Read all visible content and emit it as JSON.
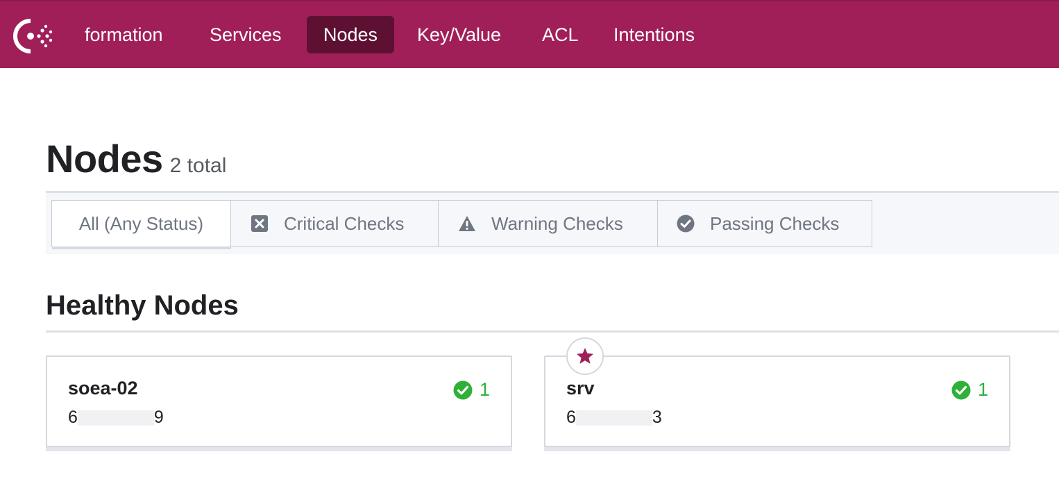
{
  "colors": {
    "brand": "#a01f58",
    "nav_active": "#5e1033",
    "passing": "#2eb039",
    "leader_star": "#a01f58"
  },
  "nav": {
    "logo_icon": "consul-logo-icon",
    "items": [
      {
        "label": "formation",
        "active": false
      },
      {
        "label": "Services",
        "active": false
      },
      {
        "label": "Nodes",
        "active": true
      },
      {
        "label": "Key/Value",
        "active": false
      },
      {
        "label": "ACL",
        "active": false
      },
      {
        "label": "Intentions",
        "active": false
      }
    ]
  },
  "page": {
    "title": "Nodes",
    "count": "2 total"
  },
  "filters": {
    "selected": "All (Any Status)",
    "tabs": [
      {
        "label": "All (Any Status)",
        "icon": null
      },
      {
        "label": "Critical Checks",
        "icon": "critical-x-icon"
      },
      {
        "label": "Warning Checks",
        "icon": "warning-triangle-icon"
      },
      {
        "label": "Passing Checks",
        "icon": "passing-check-icon"
      }
    ]
  },
  "section": {
    "title": "Healthy Nodes"
  },
  "nodes": [
    {
      "name": "soea-02",
      "address_start": "6",
      "address_end": "9",
      "passing_count": "1",
      "leader": false
    },
    {
      "name": "srv",
      "address_start": "6",
      "address_end": "3",
      "passing_count": "1",
      "leader": true,
      "leader_icon": "star-icon"
    }
  ]
}
